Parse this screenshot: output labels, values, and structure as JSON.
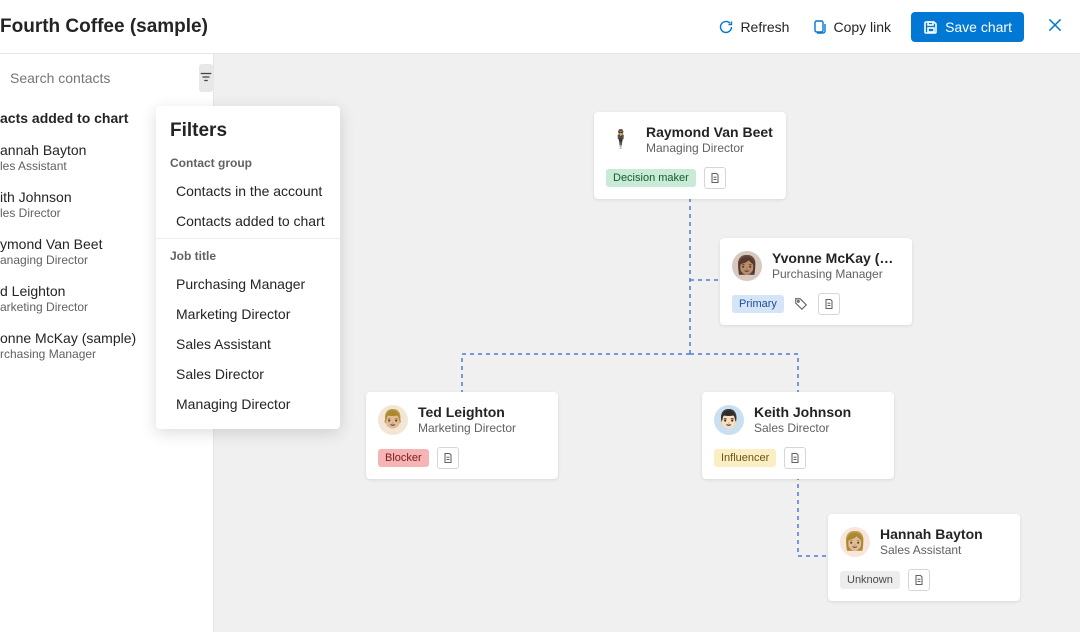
{
  "header": {
    "title": "Fourth Coffee (sample)",
    "refresh_label": "Refresh",
    "copylink_label": "Copy link",
    "save_label": "Save chart"
  },
  "sidebar": {
    "search_placeholder": "Search contacts",
    "section_title": "acts added to chart",
    "contacts": [
      {
        "name": "annah Bayton",
        "title": "les Assistant"
      },
      {
        "name": "ith Johnson",
        "title": "les Director"
      },
      {
        "name": "ymond Van Beet",
        "title": "anaging Director"
      },
      {
        "name": "d Leighton",
        "title": "arketing Director"
      },
      {
        "name": "onne McKay (sample)",
        "title": "rchasing Manager"
      }
    ]
  },
  "filters": {
    "title": "Filters",
    "group1_label": "Contact group",
    "group1_options": [
      "Contacts in the account",
      "Contacts added to chart"
    ],
    "group2_label": "Job title",
    "group2_options": [
      "Purchasing Manager",
      "Marketing Director",
      "Sales Assistant",
      "Sales Director",
      "Managing Director"
    ]
  },
  "nodes": {
    "raymond": {
      "name": "Raymond Van Beet",
      "role": "Managing Director",
      "tag": "Decision maker"
    },
    "yvonne": {
      "name": "Yvonne McKay (sam...",
      "role": "Purchasing Manager",
      "tag": "Primary"
    },
    "ted": {
      "name": "Ted Leighton",
      "role": "Marketing Director",
      "tag": "Blocker"
    },
    "keith": {
      "name": "Keith Johnson",
      "role": "Sales Director",
      "tag": "Influencer"
    },
    "hannah": {
      "name": "Hannah Bayton",
      "role": "Sales Assistant",
      "tag": "Unknown"
    }
  }
}
